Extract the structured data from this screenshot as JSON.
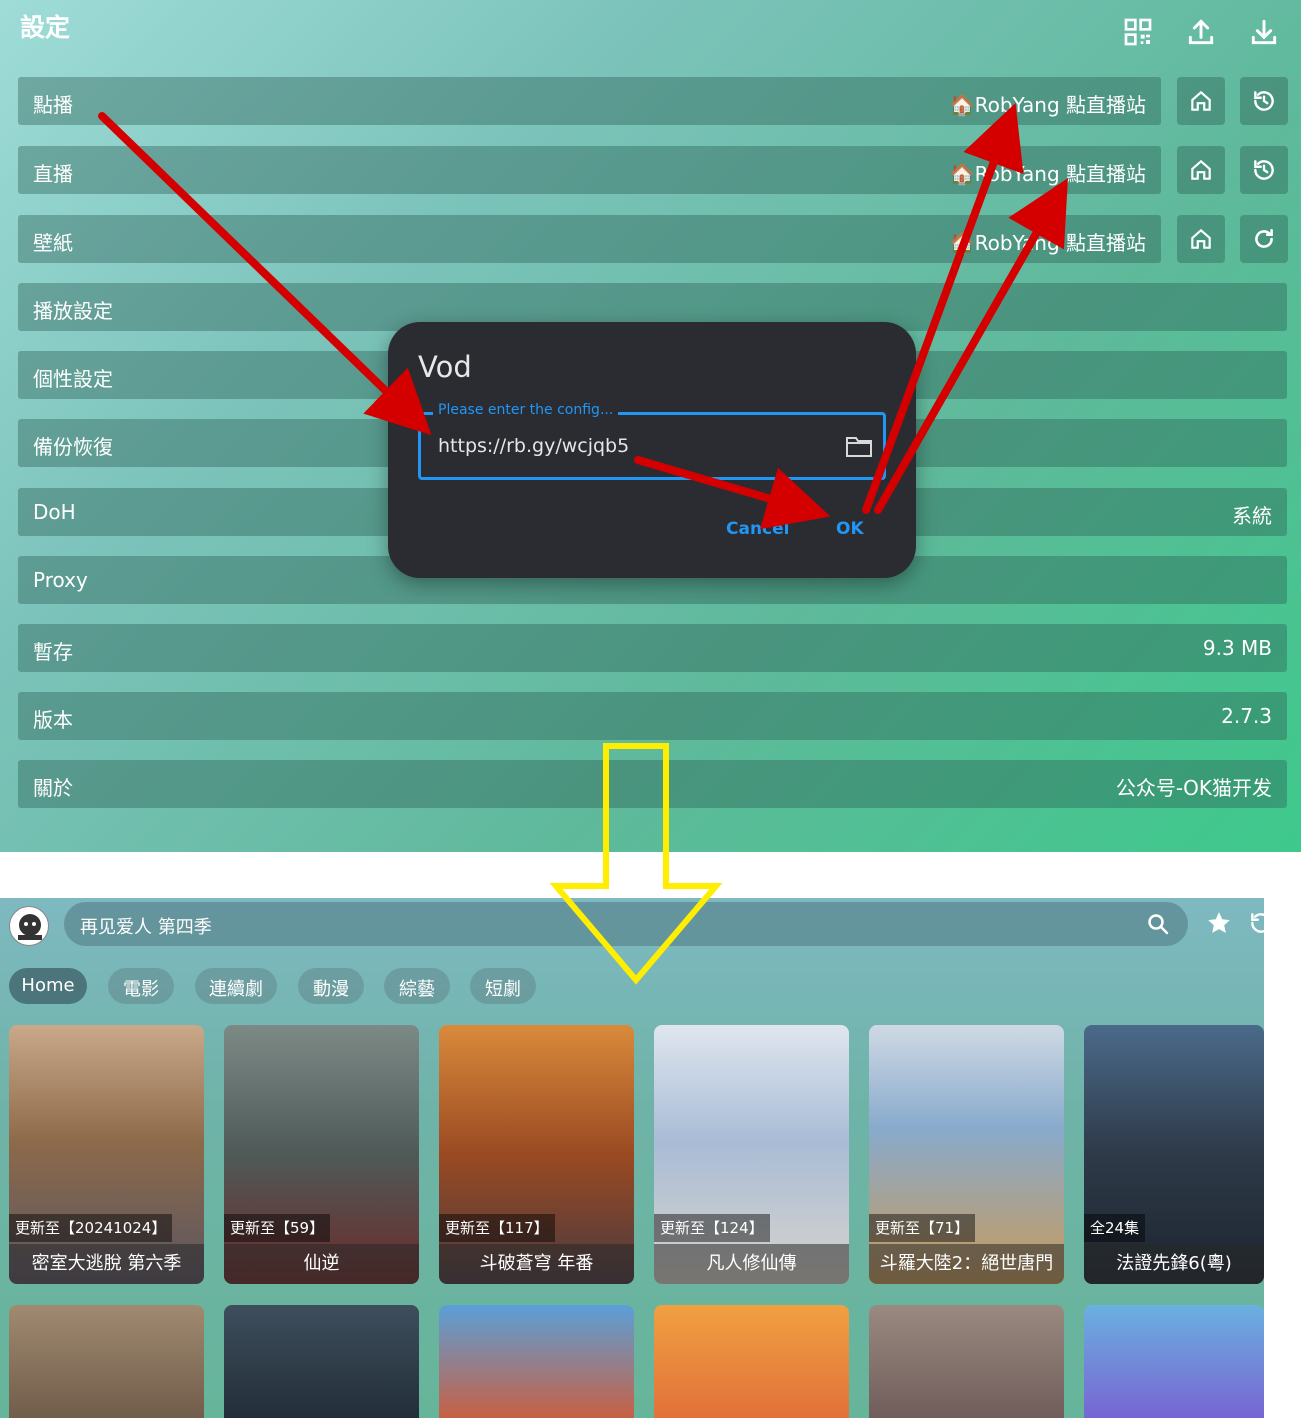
{
  "settings": {
    "title": "設定",
    "rows": [
      {
        "label": "點播",
        "value": "🏠RobYang 點直播站"
      },
      {
        "label": "直播",
        "value": "🏠RobYang 點直播站"
      },
      {
        "label": "壁紙",
        "value": "🏠RobYang 點直播站"
      },
      {
        "label": "播放設定",
        "value": ""
      },
      {
        "label": "個性設定",
        "value": ""
      },
      {
        "label": "備份恢復",
        "value": ""
      },
      {
        "label": "DoH",
        "value": "系統"
      },
      {
        "label": "Proxy",
        "value": ""
      },
      {
        "label": "暫存",
        "value": "9.3 MB"
      },
      {
        "label": "版本",
        "value": "2.7.3"
      },
      {
        "label": "關於",
        "value": "公众号-OK猫开发"
      }
    ],
    "top_icons": [
      "qr-code-icon",
      "upload-icon",
      "download-icon"
    ],
    "row_icons": [
      "home-icon",
      "history-icon",
      "refresh-icon"
    ]
  },
  "dialog": {
    "title": "Vod",
    "field_label": "Please enter the config...",
    "field_value": "https://rb.gy/wcjqb5",
    "cancel": "Cancel",
    "ok": "OK"
  },
  "home": {
    "search_text": "再见爱人 第四季",
    "tabs": [
      "Home",
      "電影",
      "連續劇",
      "動漫",
      "綜藝",
      "短劇"
    ],
    "cards": [
      {
        "badge": "更新至【20241024】",
        "title": "密室大逃脫 第六季",
        "color": "#b8804a"
      },
      {
        "badge": "更新至【59】",
        "title": "仙逆",
        "color": "#5e6a66"
      },
      {
        "badge": "更新至【117】",
        "title": "斗破蒼穹 年番",
        "color": "#b06a30"
      },
      {
        "badge": "更新至【124】",
        "title": "凡人修仙傳",
        "color": "#8fa8c8"
      },
      {
        "badge": "更新至【71】",
        "title": "斗羅大陸2：絕世唐門",
        "color": "#6e9cc0"
      },
      {
        "badge": "全24集",
        "title": "法證先鋒6(粵)",
        "color": "#3c4a5a"
      }
    ],
    "card_colors_row2": [
      "#8a7560",
      "#2d3c48",
      "#d46a3a",
      "#e89a40",
      "#8a6e66",
      "#7a6ad0"
    ]
  },
  "colors": {
    "accent": "#2196f3",
    "annotation_arrow_red": "#d40000",
    "annotation_arrow_yellow": "#ffee00"
  }
}
